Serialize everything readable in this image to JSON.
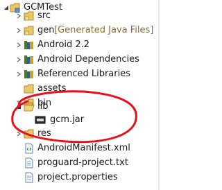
{
  "tree": {
    "project": "GCMTest",
    "items": [
      {
        "label": "src",
        "icon": "source-folder-icon"
      },
      {
        "label": "gen",
        "decoration": "[Generated Java Files]",
        "icon": "source-folder-icon"
      },
      {
        "label": "Android 2.2",
        "icon": "library-container-icon"
      },
      {
        "label": "Android Dependencies",
        "icon": "library-container-icon"
      },
      {
        "label": "Referenced Libraries",
        "icon": "library-container-icon"
      },
      {
        "label": "assets",
        "icon": "folder-icon"
      },
      {
        "label": "bin",
        "icon": "folder-icon"
      },
      {
        "label": "lib",
        "icon": "open-folder-icon"
      },
      {
        "label": "gcm.jar",
        "icon": "jar-file-icon"
      },
      {
        "label": "res",
        "icon": "folder-icon"
      },
      {
        "label": "AndroidManifest.xml",
        "icon": "xml-file-icon"
      },
      {
        "label": "proguard-project.txt",
        "icon": "text-file-icon"
      },
      {
        "label": "project.properties",
        "icon": "text-file-icon"
      }
    ]
  },
  "colors": {
    "annotation": "#e8101a",
    "folder": "#e9c86a",
    "decoration": "#8a6d3b"
  }
}
